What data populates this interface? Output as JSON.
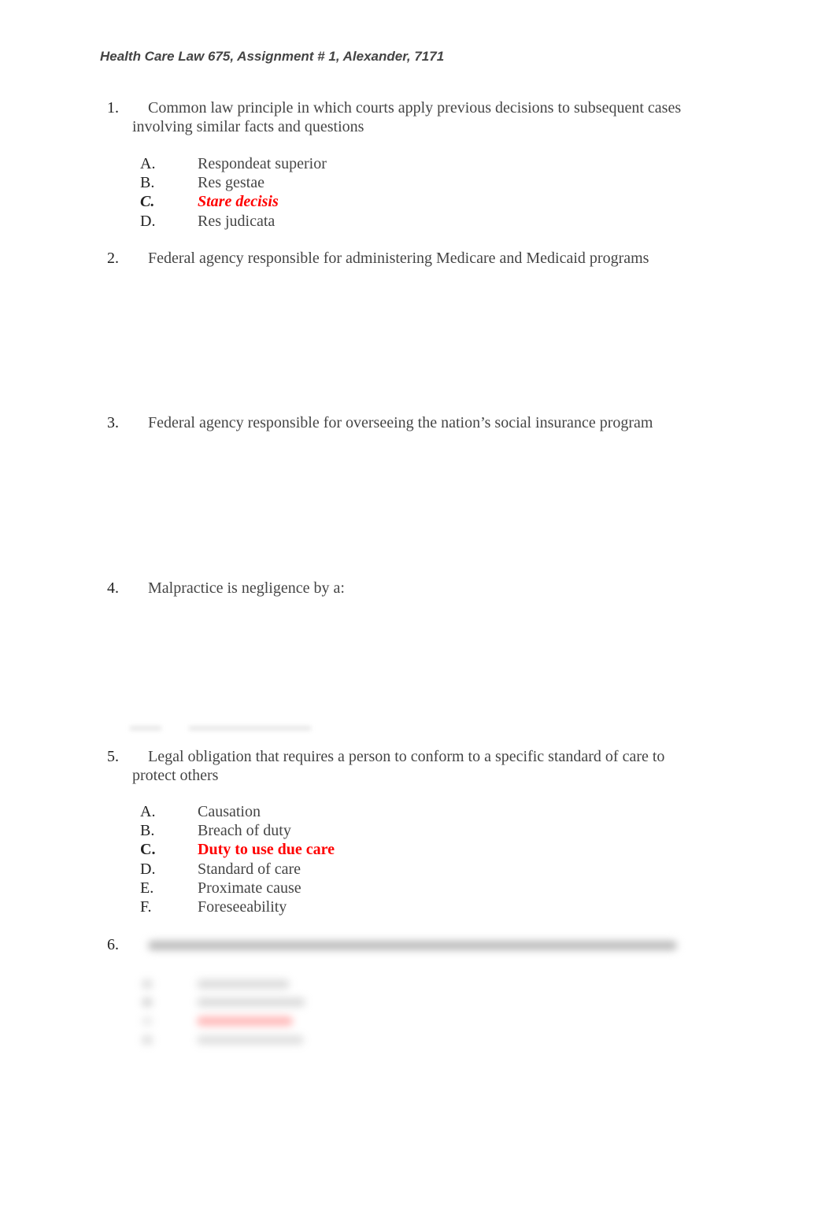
{
  "header": {
    "title": "Health Care Law 675, Assignment # 1, Alexander, 7171"
  },
  "colors": {
    "answer": "#ff0000",
    "text": "#454545",
    "label": "#222222"
  },
  "questions": [
    {
      "number": "1.",
      "line1": "Common law principle in which courts apply previous decisions to subsequent cases",
      "line2": "involving similar facts and questions",
      "options": [
        {
          "letter": "A.",
          "text": "Respondeat superior"
        },
        {
          "letter": "B.",
          "text": "Res gestae"
        },
        {
          "letter": "C.",
          "text": "Stare decisis",
          "correct": true
        },
        {
          "letter": "D.",
          "text": "Res judicata"
        }
      ]
    },
    {
      "number": "2.",
      "line1": "Federal agency responsible for administering Medicare and Medicaid programs"
    },
    {
      "number": "3.",
      "line1": "Federal agency responsible for overseeing the nation’s social insurance program"
    },
    {
      "number": "4.",
      "line1": "Malpractice is negligence by a:"
    },
    {
      "number": "5.",
      "line1": "Legal obligation that requires a person to conform to a specific standard of care to",
      "line2": "protect others",
      "options": [
        {
          "letter": "A.",
          "text": "Causation"
        },
        {
          "letter": "B.",
          "text": "Breach of duty"
        },
        {
          "letter": "C.",
          "text": "Duty to use due care",
          "correct": true
        },
        {
          "letter": "D.",
          "text": "Standard of care"
        },
        {
          "letter": "E.",
          "text": "Proximate cause"
        },
        {
          "letter": "F.",
          "text": "Foreseeability"
        }
      ]
    },
    {
      "number": "6.",
      "blurred": true
    }
  ]
}
